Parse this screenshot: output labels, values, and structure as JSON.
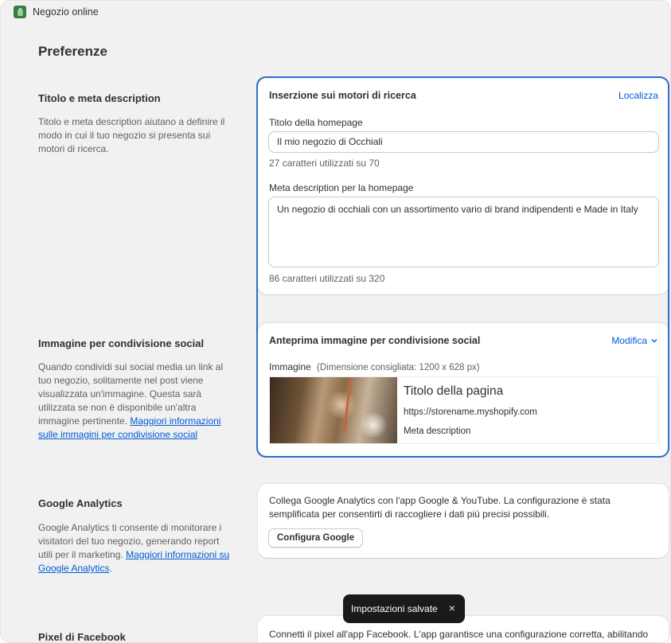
{
  "app": {
    "title": "Negozio online"
  },
  "page": {
    "title": "Preferenze"
  },
  "sections": {
    "seo": {
      "heading": "Titolo e meta description",
      "description": "Titolo e meta description aiutano a definire il modo in cui il tuo negozio si presenta sui motori di ricerca."
    },
    "social": {
      "heading": "Immagine per condivisione social",
      "description": "Quando condividi sui social media un link al tuo negozio, solitamente nel post viene visualizzata un'immagine. Questa sarà utilizzata se non è disponibile un'altra immagine pertinente.",
      "link": "Maggiori informazioni sulle immagini per condivisione social"
    },
    "analytics": {
      "heading": "Google Analytics",
      "description": "Google Analytics ti consente di monitorare i visitatori del tuo negozio, generando report utili per il marketing.",
      "link": "Maggiori informazioni su Google Analytics",
      "suffix": "."
    },
    "facebook": {
      "heading": "Pixel di Facebook"
    }
  },
  "seo_card": {
    "title": "Inserzione sui motori di ricerca",
    "action": "Localizza",
    "homepage_title_label": "Titolo della homepage",
    "homepage_title_value": "Il mio negozio di Occhiali",
    "homepage_title_count": "27 caratteri utilizzati su 70",
    "meta_label": "Meta description per la homepage",
    "meta_value": "Un negozio di occhiali con un assortimento vario di brand indipendenti e Made in Italy",
    "meta_count": "86 caratteri utilizzati su 320"
  },
  "social_card": {
    "title": "Anteprima immagine per condivisione social",
    "action": "Modifica",
    "image_label": "Immagine",
    "image_hint": "(Dimensione consigliata: 1200 x 628 px)",
    "preview_title": "Titolo della pagina",
    "preview_url": "https://storename.myshopify.com",
    "preview_desc": "Meta description"
  },
  "analytics_card": {
    "text": "Collega Google Analytics con l'app Google & YouTube. La configurazione è stata semplificata per consentirti di raccogliere i dati più precisi possibili.",
    "button": "Configura Google"
  },
  "facebook_card": {
    "text": "Connetti il pixel all'app Facebook. L'app garantisce una configurazione corretta, abilitando"
  },
  "toast": {
    "message": "Impostazioni salvate",
    "close": "×"
  },
  "colors": {
    "accent": "#2c6ecb",
    "link": "#005bd3",
    "toast_bg": "#1a1a1a",
    "app_icon": "#3a7d44"
  },
  "icons": {
    "app": "shopify-bag-icon",
    "chevron": "chevron-down-icon",
    "close": "close-icon"
  }
}
